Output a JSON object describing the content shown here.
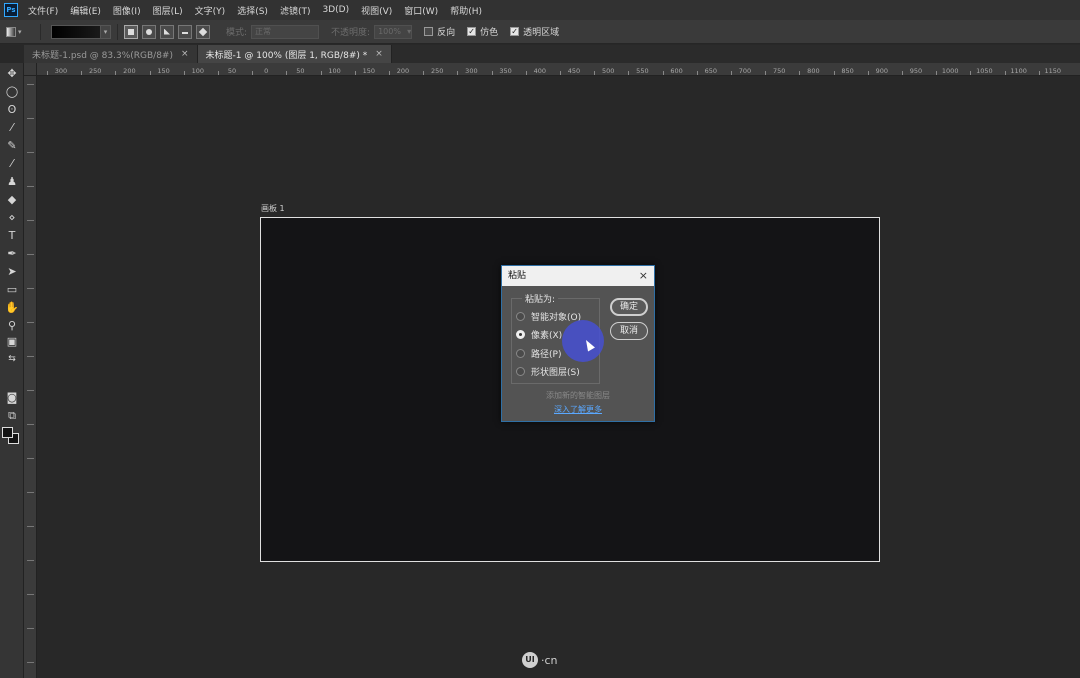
{
  "menubar": {
    "app_icon": "Ps",
    "items": [
      "文件(F)",
      "编辑(E)",
      "图像(I)",
      "图层(L)",
      "文字(Y)",
      "选择(S)",
      "滤镜(T)",
      "3D(D)",
      "视图(V)",
      "窗口(W)",
      "帮助(H)"
    ]
  },
  "options": {
    "mode_label": "模式:",
    "mode_value": "正常",
    "opacity_label": "不透明度:",
    "opacity_value": "100%",
    "reverse_label": "反向",
    "reverse_checked": false,
    "dither_label": "仿色",
    "dither_checked": true,
    "transparency_label": "透明区域",
    "transparency_checked": true
  },
  "tabs": [
    {
      "label": "未标题-1.psd @ 83.3%(RGB/8#)",
      "close": "×",
      "active": false
    },
    {
      "label": "未标题-1 @ 100% (图层 1, RGB/8#) *",
      "close": "×",
      "active": true
    }
  ],
  "ruler": {
    "ticks": [
      "300",
      "250",
      "200",
      "150",
      "100",
      "50",
      "0",
      "50",
      "100",
      "150",
      "200",
      "250",
      "300",
      "350",
      "400",
      "450",
      "500",
      "550",
      "600",
      "650",
      "700",
      "750",
      "800",
      "850",
      "900",
      "950",
      "1000",
      "1050",
      "1100",
      "1150"
    ]
  },
  "canvas": {
    "artboard_label": "画板 1"
  },
  "dialog": {
    "title": "粘贴",
    "close": "×",
    "group_label": "粘贴为:",
    "options": [
      {
        "label": "智能对象(O)",
        "selected": false
      },
      {
        "label": "像素(X)",
        "selected": true
      },
      {
        "label": "路径(P)",
        "selected": false
      },
      {
        "label": "形状图层(S)",
        "selected": false
      }
    ],
    "ok_label": "确定",
    "cancel_label": "取消",
    "hint": "添加新的智能图层",
    "link": "深入了解更多"
  },
  "watermark": {
    "badge": "UI",
    "text": "·cn"
  },
  "colors": {
    "accent_link": "#5aa8ff",
    "cursor_highlight": "#4650d2"
  }
}
